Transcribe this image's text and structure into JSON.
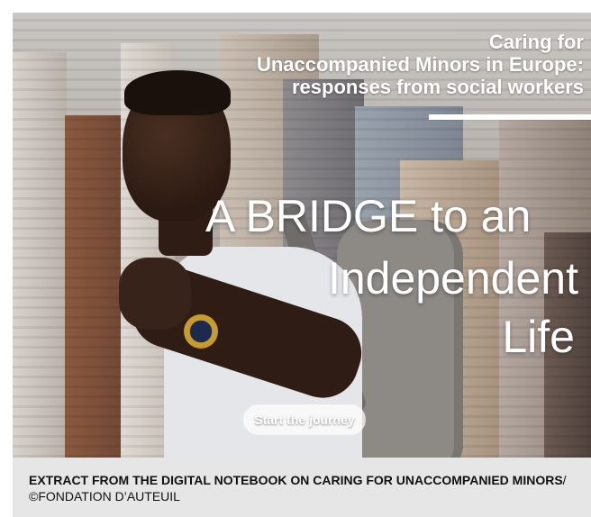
{
  "hero": {
    "title_lines": [
      "Caring for",
      "Unaccompanied Minors in Europe:",
      "responses from social workers"
    ],
    "headline_lines": [
      "A BRIDGE to an",
      "Independent",
      "Life"
    ],
    "cta_label": "Start the journey"
  },
  "caption": {
    "strong": "EXTRACT FROM THE DIGITAL NOTEBOOK ON CARING FOR UNACCOMPANIED MINORS",
    "light": "/©FONDATION D’AUTEUIL"
  }
}
